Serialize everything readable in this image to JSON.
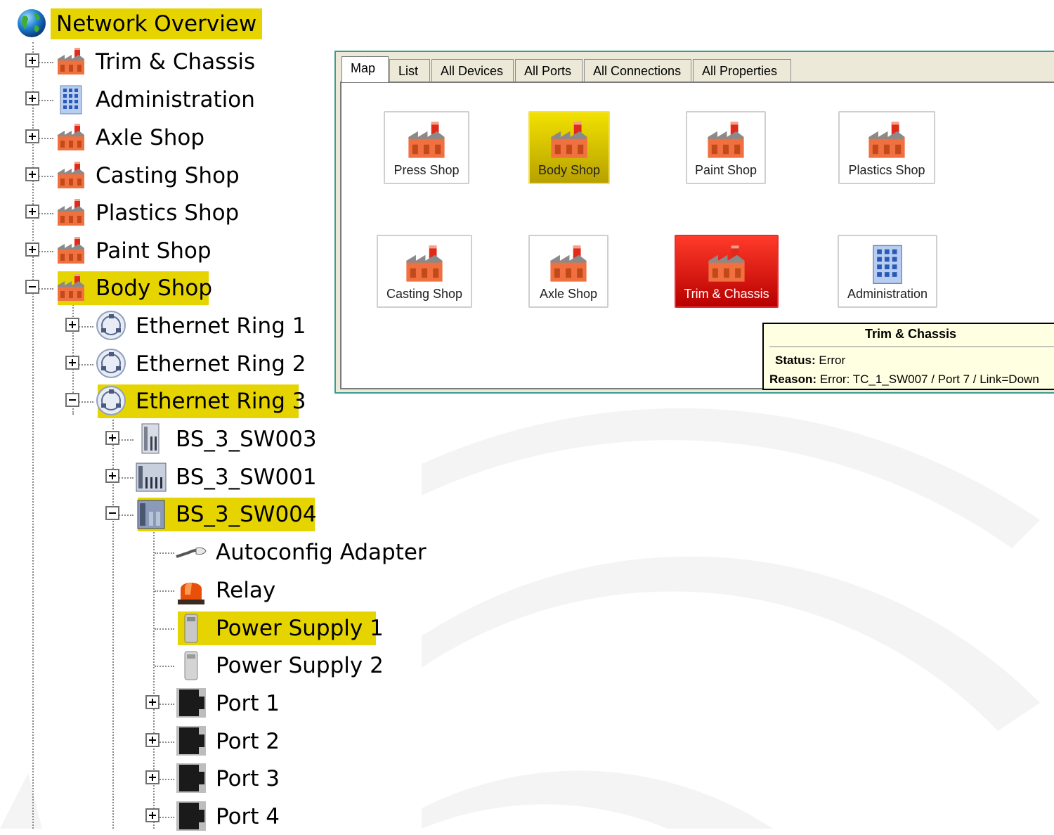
{
  "tree": {
    "root": {
      "label": "Network Overview",
      "icon": "globe-icon"
    },
    "areas": [
      {
        "label": "Trim & Chassis",
        "icon": "factory-icon",
        "expanded": false
      },
      {
        "label": "Administration",
        "icon": "office-building-icon",
        "expanded": false
      },
      {
        "label": "Axle Shop",
        "icon": "factory-icon",
        "expanded": false
      },
      {
        "label": "Casting Shop",
        "icon": "factory-icon",
        "expanded": false
      },
      {
        "label": "Plastics Shop",
        "icon": "factory-icon",
        "expanded": false
      },
      {
        "label": "Paint Shop",
        "icon": "factory-icon",
        "expanded": false
      },
      {
        "label": "Body Shop",
        "icon": "factory-icon",
        "expanded": true,
        "highlighted": true
      }
    ],
    "rings": [
      {
        "label": "Ethernet Ring 1",
        "icon": "network-ring-icon",
        "expanded": false
      },
      {
        "label": "Ethernet Ring 2",
        "icon": "network-ring-icon",
        "expanded": false
      },
      {
        "label": "Ethernet Ring 3",
        "icon": "network-ring-icon",
        "expanded": true,
        "highlighted": true
      }
    ],
    "switches": [
      {
        "label": "BS_3_SW003",
        "icon": "switch-device-icon",
        "expanded": false
      },
      {
        "label": "BS_3_SW001",
        "icon": "switch-device-icon",
        "expanded": false
      },
      {
        "label": "BS_3_SW004",
        "icon": "switch-device-icon",
        "expanded": true,
        "highlighted": true
      }
    ],
    "components": [
      {
        "label": "Autoconfig Adapter",
        "icon": "adapter-cable-icon"
      },
      {
        "label": "Relay",
        "icon": "alarm-light-icon"
      },
      {
        "label": "Power Supply 1",
        "icon": "power-supply-icon",
        "highlighted": true
      },
      {
        "label": "Power Supply 2",
        "icon": "power-supply-icon"
      }
    ],
    "ports": [
      {
        "label": "Port 1",
        "icon": "port-icon"
      },
      {
        "label": "Port 2",
        "icon": "port-icon"
      },
      {
        "label": "Port 3",
        "icon": "port-icon"
      },
      {
        "label": "Port 4",
        "icon": "port-icon"
      }
    ]
  },
  "window": {
    "tabs": [
      "Map",
      "List",
      "All Devices",
      "All Ports",
      "All Connections",
      "All Properties"
    ],
    "active_tab": "Map",
    "map_nodes": [
      {
        "label": "Press Shop",
        "icon": "factory-icon",
        "state": "normal"
      },
      {
        "label": "Body Shop",
        "icon": "factory-icon",
        "state": "selected"
      },
      {
        "label": "Paint Shop",
        "icon": "factory-icon",
        "state": "normal"
      },
      {
        "label": "Plastics Shop",
        "icon": "factory-icon",
        "state": "normal"
      },
      {
        "label": "Casting Shop",
        "icon": "factory-icon",
        "state": "normal"
      },
      {
        "label": "Axle Shop",
        "icon": "factory-icon",
        "state": "normal"
      },
      {
        "label": "Trim & Chassis",
        "icon": "factory-icon",
        "state": "error"
      },
      {
        "label": "Administration",
        "icon": "office-building-icon",
        "state": "normal"
      }
    ],
    "tooltip": {
      "title": "Trim & Chassis",
      "status_label": "Status:",
      "status_value": "Error",
      "reason_label": "Reason:",
      "reason_value": "Error: TC_1_SW007 / Port 7 / Link=Down"
    }
  },
  "colors": {
    "highlight": "#e6d400",
    "error": "#e01b10",
    "window_border": "#3a9d90",
    "tooltip_bg": "#ffffe1"
  }
}
